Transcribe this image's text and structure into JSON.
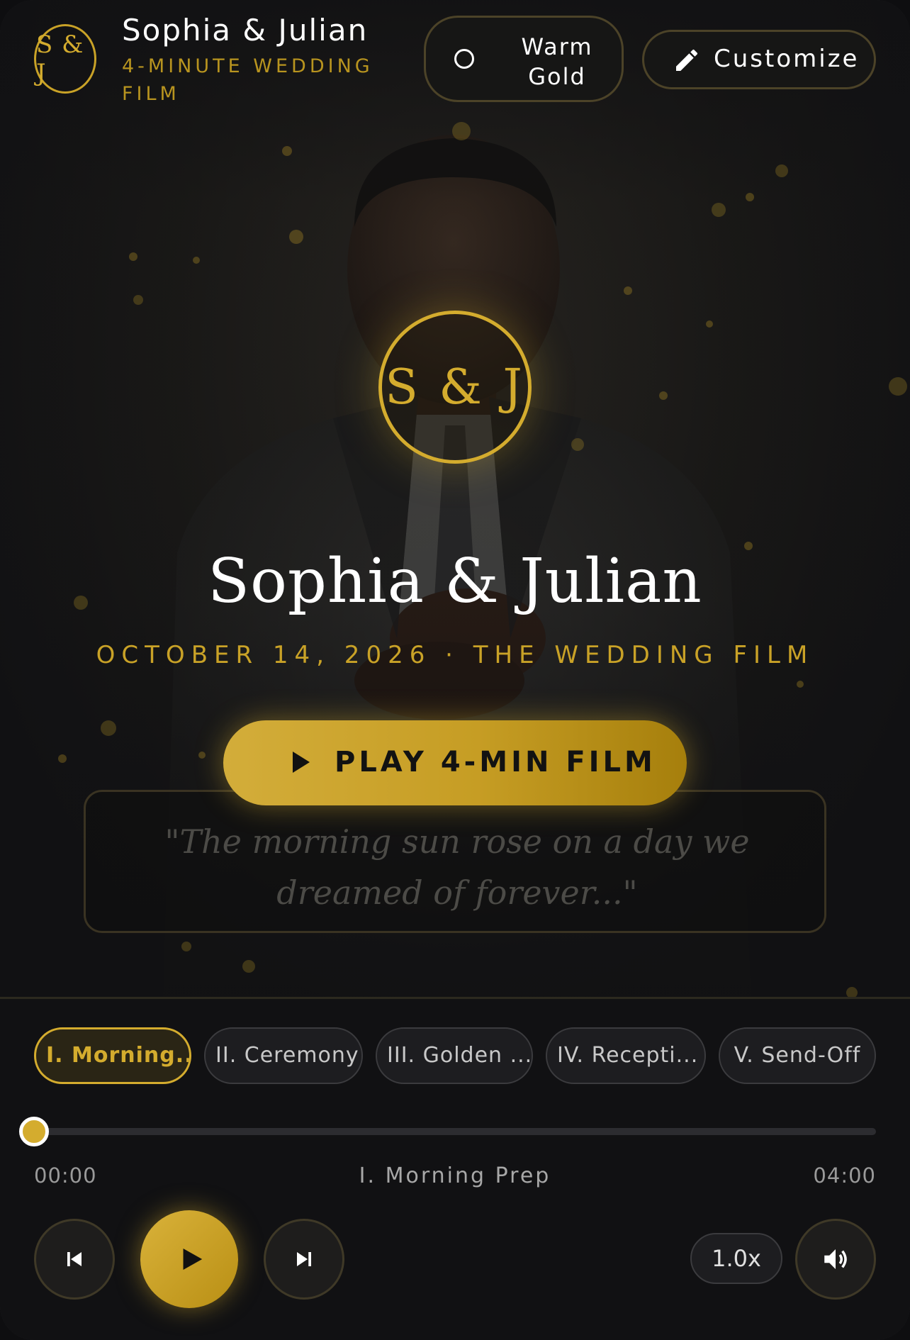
{
  "header": {
    "logo_text": "S & J",
    "title": "Sophia & Julian",
    "subtitle": "4-MINUTE WEDDING FILM",
    "theme_label": "Warm Gold",
    "customize_label": "Customize"
  },
  "hero": {
    "monogram": "S & J",
    "couple_name": "Sophia & Julian",
    "date_line": "OCTOBER 14, 2026 · THE WEDDING FILM",
    "play_label": "PLAY 4-MIN FILM",
    "quote": "\"The morning sun rose on a day we dreamed of forever...\""
  },
  "chapters": [
    {
      "label": "I. Morning...",
      "active": true
    },
    {
      "label": "II. Ceremony",
      "active": false
    },
    {
      "label": "III. Golden ...",
      "active": false
    },
    {
      "label": "IV. Recepti...",
      "active": false
    },
    {
      "label": "V. Send-Off",
      "active": false
    }
  ],
  "player": {
    "current_time": "00:00",
    "total_time": "04:00",
    "current_chapter": "I. Morning Prep",
    "progress": 0,
    "speed": "1.0x"
  },
  "colors": {
    "accent": "#d4ac2e",
    "background": "#111113"
  },
  "icons": {
    "theme": "circle-icon",
    "customize": "pencil-icon",
    "prev": "skip-previous-icon",
    "play": "play-icon",
    "next": "skip-next-icon",
    "volume": "volume-icon"
  }
}
